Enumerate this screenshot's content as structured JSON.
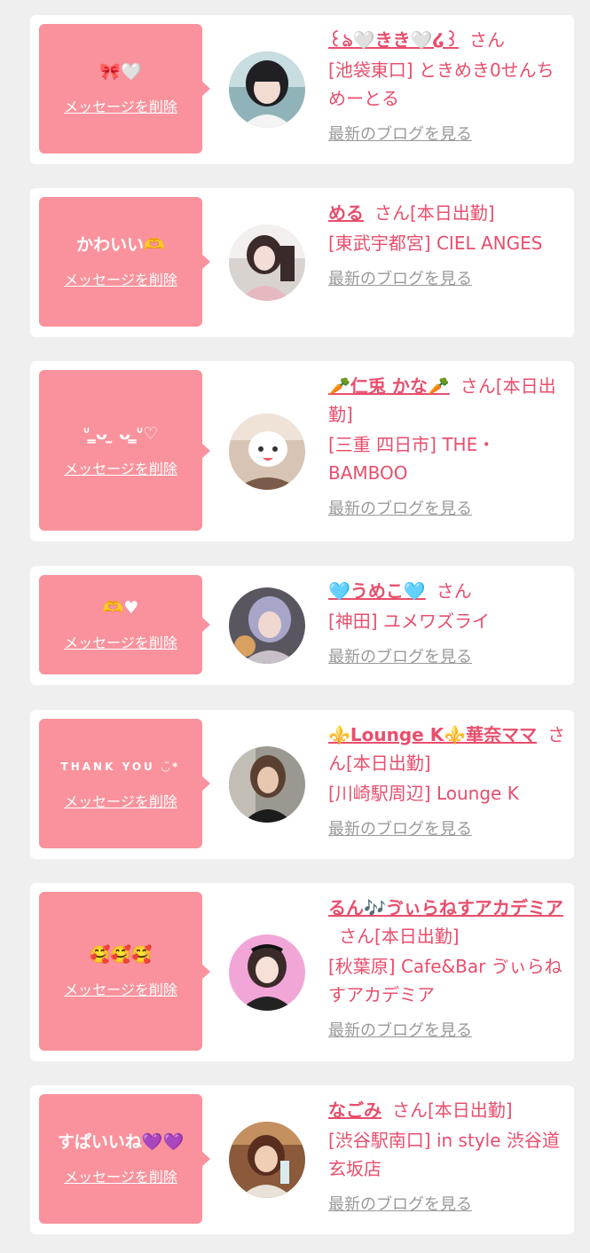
{
  "delete_label": "メッセージを削除",
  "blog_label": "最新のブログを見る",
  "colors": {
    "background": "#efefef",
    "card": "#ffffff",
    "bubble": "#f9929c",
    "accent": "#e84e6c",
    "muted": "#999999"
  },
  "entries": [
    {
      "message": "🎀🤍",
      "name": "꒰ঌ🤍きき🤍໒꒱",
      "suffix": "さん",
      "shop": "[池袋東口] ときめき0せんちめーとる"
    },
    {
      "message": "かわいい🫶",
      "name": "める",
      "suffix": "さん[本日出勤]",
      "shop": "[東武宇都宮] CIEL ANGES"
    },
    {
      "message": "ᐡ ̳ᴗ ̫ ᴗ ̳ᐡ♡",
      "name": "🥕仁兎 かな🥕",
      "suffix": "さん[本日出勤]",
      "shop": "[三重 四日市] THE・BAMBOO"
    },
    {
      "message": "🫶♥",
      "name": "🩵うめこ🩵",
      "suffix": "さん",
      "shop": "[神田] ユメワズライ"
    },
    {
      "message": "THANK YOU ◡̈*",
      "name": "⚜️Lounge K⚜️華奈ママ",
      "suffix": "さん[本日出勤]",
      "shop": "[川崎駅周辺] Lounge K"
    },
    {
      "message": "🥰🥰🥰",
      "name": "るん🎶ゔぃらねすアカデミア",
      "suffix": "さん[本日出勤]",
      "shop": "[秋葉原] Cafe&Bar ゔぃらねすアカデミア"
    },
    {
      "message": "すぱいいね💜💜",
      "name": "なごみ",
      "suffix": "さん[本日出勤]",
      "shop": "[渋谷駅南口] in style 渋谷道玄坂店"
    }
  ]
}
